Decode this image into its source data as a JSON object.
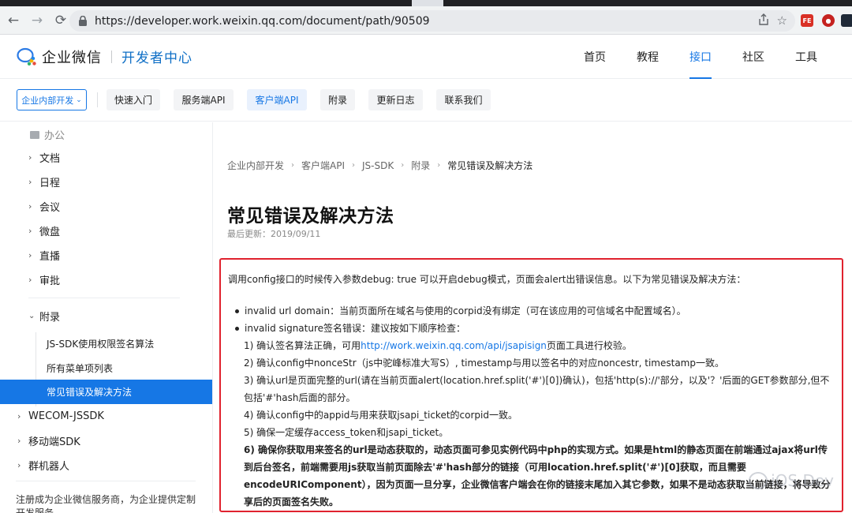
{
  "browser": {
    "url": "https://developer.work.weixin.qq.com/document/path/90509"
  },
  "header": {
    "logo_text": "企业微信",
    "logo_sub": "开发者中心",
    "nav": [
      "首页",
      "教程",
      "接口",
      "社区",
      "工具"
    ],
    "active_nav": "接口"
  },
  "subnav": {
    "dropdown": "企业内部开发",
    "items": [
      "快速入门",
      "服务端API",
      "客户端API",
      "附录",
      "更新日志",
      "联系我们"
    ],
    "active": "客户端API"
  },
  "sidebar": {
    "group": "办公",
    "items": [
      "文档",
      "日程",
      "会议",
      "微盘",
      "直播",
      "审批"
    ],
    "appendix": "附录",
    "appendix_items": [
      "JS-SDK使用权限签名算法",
      "所有菜单项列表"
    ],
    "active_item": "常见错误及解决方法",
    "lower_items": [
      "WECOM-JSSDK",
      "移动端SDK",
      "群机器人"
    ],
    "note": "注册成为企业微信服务商，为企业提供定制开发服务"
  },
  "breadcrumb": [
    "企业内部开发",
    "客户端API",
    "JS-SDK",
    "附录",
    "常见错误及解决方法"
  ],
  "page": {
    "title": "常见错误及解决方法",
    "updated": "最后更新：2019/09/11"
  },
  "notice": {
    "intro": "调用config接口的时候传入参数debug: true 可以开启debug模式，页面会alert出错误信息。以下为常见错误及解决方法：",
    "bullets": [
      "invalid url domain：当前页面所在域名与使用的corpid没有绑定（可在该应用的可信域名中配置域名）。",
      "invalid signature签名错误：建议按如下顺序检查："
    ],
    "step1_pre": "1) 确认签名算法正确，可用",
    "step1_link": "http://work.weixin.qq.com/api/jsapisign",
    "step1_post": "页面工具进行校验。",
    "step2": "2) 确认config中nonceStr（js中驼峰标准大写S）, timestamp与用以签名中的对应noncestr, timestamp一致。",
    "step3": "3) 确认url是页面完整的url(请在当前页面alert(location.href.split('#')[0])确认)，包括'http(s)://'部分，以及'？'后面的GET参数部分,但不包括'#'hash后面的部分。",
    "step4": "4) 确认config中的appid与用来获取jsapi_ticket的corpid一致。",
    "step5": "5) 确保一定缓存access_token和jsapi_ticket。",
    "step6": "6) 确保你获取用来签名的url是动态获取的，动态页面可参见实例代码中php的实现方式。如果是html的静态页面在前端通过ajax将url传到后台签名，前端需要用js获取当前页面除去'#'hash部分的链接（可用location.href.split('#')[0]获取，而且需要encodeURIComponent），因为页面一旦分享，企业微信客户端会在你的链接末尾加入其它参数，如果不是动态获取当前链接，将导致分享后的页面签名失败。"
  },
  "watermark": "iOS Dev"
}
